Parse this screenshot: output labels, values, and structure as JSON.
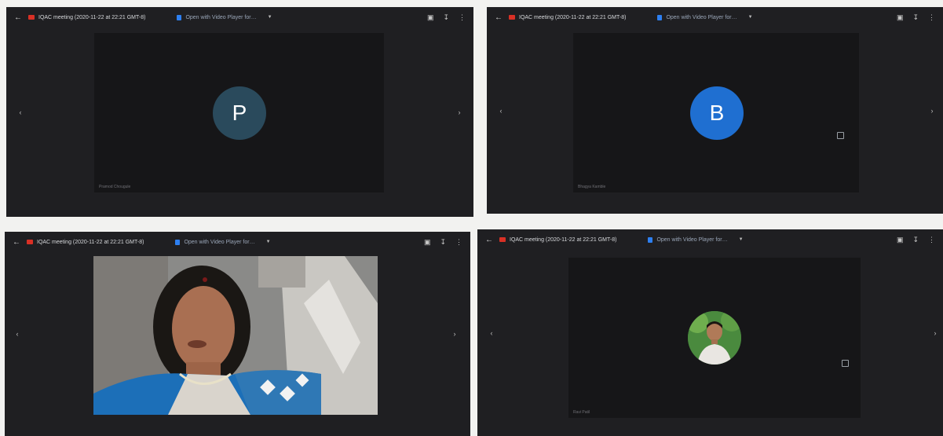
{
  "panels": [
    {
      "title": "IQAC meeting (2020-11-22 at 22:21 GMT-8)",
      "open_with": "Open with Video Player for…",
      "participant_name": "Pramod Chougule",
      "avatar_letter": "P",
      "avatar_color": "#2a4a5c"
    },
    {
      "title": "IQAC meeting (2020-11-22 at 22:21 GMT-8)",
      "open_with": "Open with Video Player for…",
      "participant_name": "Bhagya Kamble",
      "avatar_letter": "B",
      "avatar_color": "#1f6fd1"
    },
    {
      "title": "IQAC meeting (2020-11-22 at 22:21 GMT-8)",
      "open_with": "Open with Video Player for…",
      "participant_name": "",
      "video": "woman-speaking-webcam"
    },
    {
      "title": "IQAC meeting (2020-11-22 at 22:21 GMT-8)",
      "open_with": "Open with Video Player for…",
      "participant_name": "Ravi Patil",
      "avatar": "man-photo-avatar"
    }
  ],
  "tool_icons": [
    "add-to-drive-icon",
    "download-icon",
    "more-vert-icon"
  ]
}
